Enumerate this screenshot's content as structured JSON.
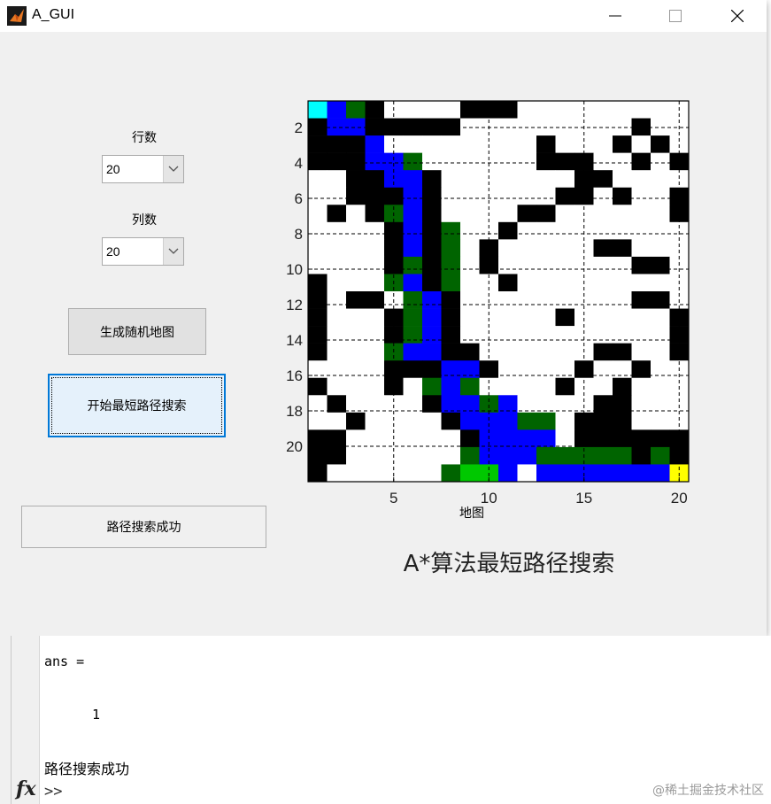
{
  "window": {
    "title": "A_GUI"
  },
  "controls": {
    "rows_label": "行数",
    "rows_value": "20",
    "cols_label": "列数",
    "cols_value": "20",
    "generate_button": "生成随机地图",
    "search_button": "开始最短路径搜索",
    "status_text": "路径搜索成功"
  },
  "plot": {
    "title": "A*算法最短路径搜索",
    "xlabel": "地图",
    "x_ticks": [
      "5",
      "10",
      "15",
      "20"
    ],
    "y_ticks": [
      "2",
      "4",
      "6",
      "8",
      "10",
      "12",
      "14",
      "16",
      "18",
      "20"
    ],
    "colors": {
      "free": "#ffffff",
      "wall": "#000000",
      "path": "#0000ff",
      "explored": "#006400",
      "open": "#00c800",
      "start": "#00ffff",
      "goal": "#ffff00"
    },
    "legend_codes": "0=free,1=wall,2=path,3=explored,4=open,5=start,6=goal",
    "grid": [
      "52310000111000000000",
      "12211111000000000100",
      "11120000000010001010",
      "11122300000011100101",
      "00112210000000110000",
      "00111210000001101001",
      "01013210000110000001",
      "00001213001000000000",
      "00001213010000011000",
      "00001313010000000110",
      "10003213001000000000",
      "10110321000000000110",
      "10001321000001000001",
      "10001321000000000001",
      "10003221100000011001",
      "00001112210000100100",
      "10001032300001001000",
      "01000012232000011000",
      "00100001222330111000",
      "11000000122220111111",
      "11000000322233333131",
      "10000003442022222226"
    ]
  },
  "console": {
    "ans_line": "ans =",
    "value_line": "1",
    "message_line": "路径搜索成功",
    "prompt": ">>",
    "fx_label": "fx",
    "watermark": "@稀土掘金技术社区"
  }
}
